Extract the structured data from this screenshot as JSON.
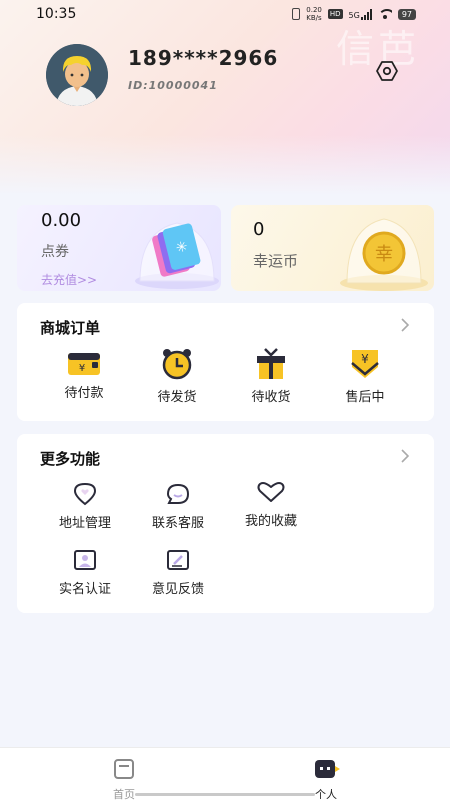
{
  "status_bar": {
    "time": "10:35",
    "net_speed_value": "0.20",
    "net_speed_unit": "KB/s",
    "hd_badge": "HD",
    "network_type": "5G",
    "battery": "97"
  },
  "header": {
    "watermark_text": "信芭",
    "phone": "189****2966",
    "user_id": "ID:10000041"
  },
  "wallet": {
    "points": {
      "amount": "0.00",
      "label": "点券",
      "link": "去充值>>"
    },
    "coins": {
      "amount": "0",
      "label": "幸运币",
      "coin_glyph": "幸"
    }
  },
  "orders": {
    "title": "商城订单",
    "items": [
      {
        "label": "待付款",
        "icon": "wallet-icon"
      },
      {
        "label": "待发货",
        "icon": "alarm-clock-icon"
      },
      {
        "label": "待收货",
        "icon": "gift-box-icon"
      },
      {
        "label": "售后中",
        "icon": "yen-shield-icon"
      }
    ]
  },
  "more_functions": {
    "title": "更多功能",
    "items": [
      {
        "label": "地址管理",
        "icon": "location-heart-icon"
      },
      {
        "label": "联系客服",
        "icon": "chat-bubble-icon"
      },
      {
        "label": "我的收藏",
        "icon": "heart-icon"
      },
      {
        "label": "实名认证",
        "icon": "id-card-icon"
      },
      {
        "label": "意见反馈",
        "icon": "edit-note-icon"
      }
    ]
  },
  "tabbar": {
    "home": "首页",
    "me": "个人"
  },
  "colors": {
    "accent_yellow": "#f7c325",
    "link_purple": "#b08be0",
    "icon_dark": "#2b2b3a"
  }
}
